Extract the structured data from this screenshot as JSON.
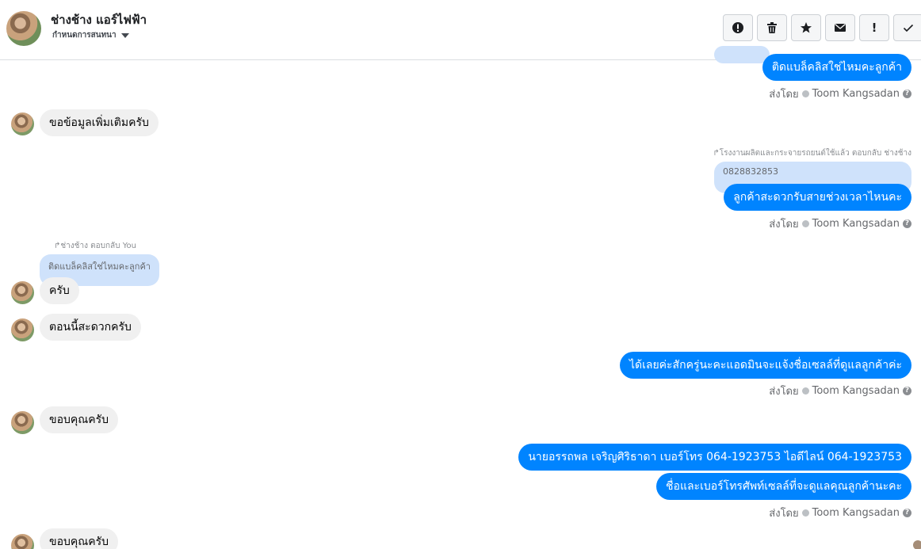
{
  "header": {
    "name": "ช่างช้าง แอร์ไฟฟ้า",
    "subtitle": "กำหนดการสนทนา",
    "toolbar_icons": [
      "alert-icon",
      "trash-icon",
      "star-icon",
      "mail-icon",
      "exclamation-icon",
      "check-icon"
    ],
    "exclamation_text": "!"
  },
  "messages": {
    "m1_out": "ติดแบล็คลิสใช่ไหมคะลูกค้า",
    "m1_sent_by": "ส่งโดย",
    "m1_sender": "Toom Kangsadan",
    "m2_in": "ขอข้อมูลเพิ่มเติมครับ",
    "m3_reply_note": "โรงงานผลิตและกระจายรถยนต์ใช้แล้ว ตอบกลับ ช่างช้าง",
    "m3_quote": "0828832853",
    "m3_out": "ลูกค้าสะดวกรับสายช่วงเวลาไหนคะ",
    "m3_sent_by": "ส่งโดย",
    "m3_sender": "Toom Kangsadan",
    "m4_reply_note": "ช่างช้าง ตอบกลับ You",
    "m4_quote": "ติดแบล็คลิสใช่ไหมคะลูกค้า",
    "m4_in": "ครับ",
    "m5_in": "ตอนนี้สะดวกครับ",
    "m6_out": "ได้เลยค่ะสักครู่นะคะแอดมินจะแจ้งชื่อเซลล์ที่ดูแลลูกค้าค่ะ",
    "m6_sent_by": "ส่งโดย",
    "m6_sender": "Toom Kangsadan",
    "m7_in": "ขอบคุณครับ",
    "m8_out": "นายอรรถพล เจริญศิริธาดา     เบอร์โทร 064-1923753 ไอดีไลน์ 064-1923753",
    "m9_out": "ชื่อและเบอร์โทรศัพท์เซลล์ที่จะดูแลคุณลูกค้านะคะ",
    "m9_sent_by": "ส่งโดย",
    "m9_sender": "Toom Kangsadan",
    "m10_in": "ขอบคุณครับ"
  }
}
